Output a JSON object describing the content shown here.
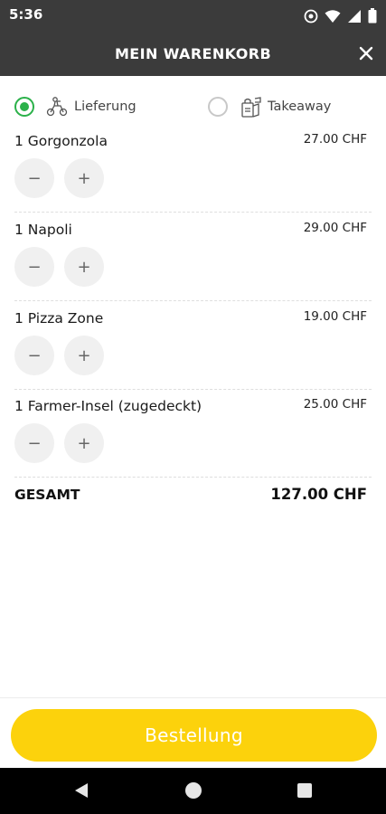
{
  "status_bar": {
    "time": "5:36",
    "icons": [
      "alarm-icon",
      "wifi-icon",
      "signal-icon",
      "battery-icon"
    ]
  },
  "header": {
    "title": "MEIN WARENKORB",
    "close_icon": "close-icon"
  },
  "delivery": {
    "options": [
      {
        "label": "Lieferung",
        "selected": true,
        "icon": "scooter-icon"
      },
      {
        "label": "Takeaway",
        "selected": false,
        "icon": "takeaway-bag-icon"
      }
    ]
  },
  "cart": {
    "items": [
      {
        "name": "1 Gorgonzola",
        "price": "27.00 CHF",
        "minus": "−",
        "plus": "+"
      },
      {
        "name": "1 Napoli",
        "price": "29.00 CHF",
        "minus": "−",
        "plus": "+"
      },
      {
        "name": "1 Pizza Zone",
        "price": "19.00 CHF",
        "minus": "−",
        "plus": "+"
      },
      {
        "name": "1 Farmer-Insel (zugedeckt)",
        "price": "25.00 CHF",
        "minus": "−",
        "plus": "+"
      }
    ],
    "total_label": "GESAMT",
    "total_value": "127.00 CHF"
  },
  "order_button": {
    "label": "Bestellung"
  },
  "colors": {
    "header_bg": "#3b3b3b",
    "accent_green": "#2bb14a",
    "button_yellow": "#fcd20c"
  },
  "nav_bar": {
    "icons": [
      "back-icon",
      "home-icon",
      "recents-icon"
    ]
  }
}
